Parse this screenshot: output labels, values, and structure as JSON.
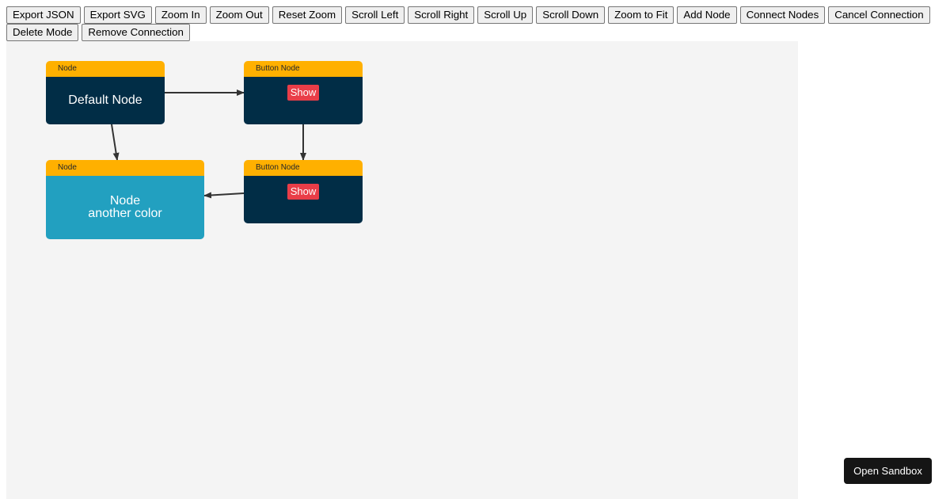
{
  "toolbar": {
    "buttons": [
      {
        "label": "Export JSON"
      },
      {
        "label": "Export SVG"
      },
      {
        "label": "Zoom In"
      },
      {
        "label": "Zoom Out"
      },
      {
        "label": "Reset Zoom"
      },
      {
        "label": "Scroll Left"
      },
      {
        "label": "Scroll Right"
      },
      {
        "label": "Scroll Up"
      },
      {
        "label": "Scroll Down"
      },
      {
        "label": "Zoom to Fit"
      },
      {
        "label": "Add Node"
      },
      {
        "label": "Connect Nodes"
      },
      {
        "label": "Cancel Connection"
      },
      {
        "label": "Delete Mode"
      },
      {
        "label": "Remove Connection"
      }
    ]
  },
  "canvas": {
    "background": "#f4f4f4",
    "nodes": [
      {
        "id": "node-1",
        "header": "Node",
        "label": "Default Node",
        "color": "#012d46"
      },
      {
        "id": "node-2",
        "header": "Button Node",
        "button_label": "Show",
        "color": "#012d46"
      },
      {
        "id": "node-3",
        "header": "Node",
        "label_lines": [
          "Node",
          "another color"
        ],
        "color": "#22a0c0"
      },
      {
        "id": "node-4",
        "header": "Button Node",
        "button_label": "Show",
        "color": "#012d46"
      }
    ],
    "connections": [
      {
        "from": "node-1",
        "to": "node-2"
      },
      {
        "from": "node-1",
        "to": "node-3"
      },
      {
        "from": "node-2",
        "to": "node-4"
      },
      {
        "from": "node-4",
        "to": "node-3"
      }
    ]
  },
  "colors": {
    "header": "#ffb000",
    "button": "#e93d48",
    "edge": "#333333"
  },
  "sandbox": {
    "label": "Open Sandbox"
  }
}
